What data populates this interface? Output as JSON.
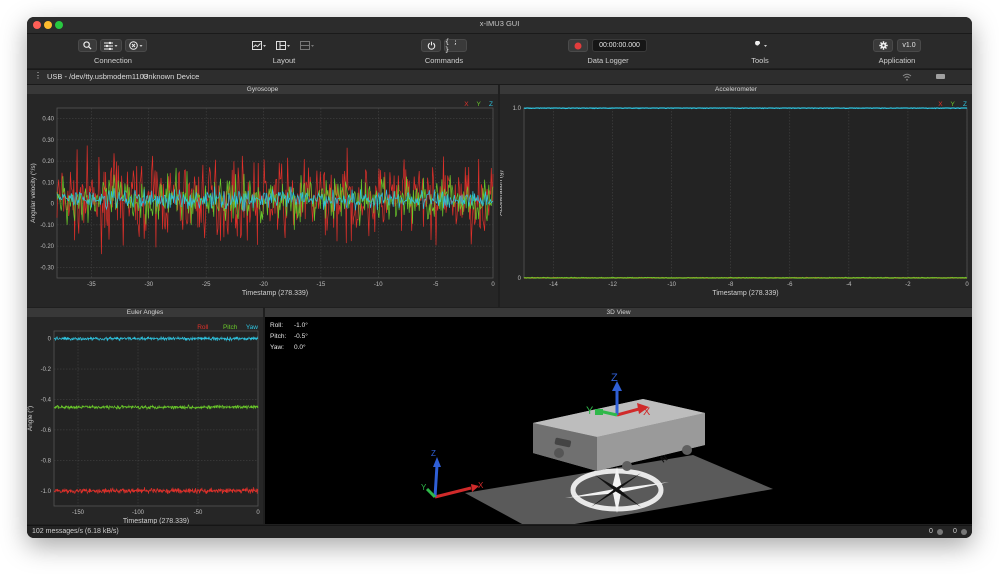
{
  "window": {
    "title": "x-IMU3 GUI"
  },
  "toolbar": {
    "connection_label": "Connection",
    "layout_label": "Layout",
    "commands_label": "Commands",
    "commands_btn": "{ ; }",
    "data_logger_label": "Data Logger",
    "timer": "00:00:00.000",
    "tools_label": "Tools",
    "application_label": "Application",
    "version": "v1.0"
  },
  "connection": {
    "port": "USB - /dev/tty.usbmodem1103",
    "device": "Unknown Device"
  },
  "gyroscope": {
    "title": "Gyroscope",
    "legend": [
      "X",
      "Y",
      "Z"
    ],
    "ylabel": "Angular velocity (°/s)",
    "xlabel": "Timestamp (278.339)",
    "yticks": [
      "0.40",
      "0.30",
      "0.20",
      "0.10",
      "0",
      "-0.10",
      "-0.20",
      "-0.30"
    ],
    "xticks": [
      "-35",
      "-30",
      "-25",
      "-20",
      "-15",
      "-10",
      "-5",
      "0"
    ]
  },
  "accelerometer": {
    "title": "Accelerometer",
    "legend": [
      "X",
      "Y",
      "Z"
    ],
    "ylabel": "Acceleration (g)",
    "xlabel": "Timestamp (278.339)",
    "yticks": [
      "1.0",
      "0"
    ],
    "xticks": [
      "-14",
      "-12",
      "-10",
      "-8",
      "-6",
      "-4",
      "-2",
      "0"
    ]
  },
  "euler": {
    "title": "Euler Angles",
    "legend": [
      "Roll",
      "Pitch",
      "Yaw"
    ],
    "ylabel": "Angle (°)",
    "xlabel": "Timestamp (278.339)",
    "yticks": [
      "0",
      "-0.2",
      "-0.4",
      "-0.6",
      "-0.8",
      "-1.0"
    ],
    "xticks": [
      "-150",
      "-100",
      "-50",
      "0"
    ]
  },
  "view3d": {
    "title": "3D View",
    "roll_label": "Roll:",
    "roll_value": "-1.0°",
    "pitch_label": "Pitch:",
    "pitch_value": "-0.5°",
    "yaw_label": "Yaw:",
    "yaw_value": "0.0°",
    "axis_x": "X",
    "axis_y": "Y",
    "axis_z": "Z",
    "compass_n": "N"
  },
  "status": {
    "rate": "102 messages/s (6.18 kB/s)",
    "count_a": "0",
    "count_b": "0"
  },
  "colors": {
    "x": "#e0302a",
    "y": "#6ac92a",
    "z": "#2ec4e0",
    "accent": "#e23c3c"
  },
  "chart_data": [
    {
      "type": "line",
      "title": "Gyroscope",
      "xlabel": "Timestamp (278.339)",
      "ylabel": "Angular velocity (°/s)",
      "xlim": [
        -38,
        0
      ],
      "ylim": [
        -0.35,
        0.45
      ],
      "series": [
        {
          "name": "X",
          "mean": 0.02,
          "spread": 0.3
        },
        {
          "name": "Y",
          "mean": 0.02,
          "spread": 0.18
        },
        {
          "name": "Z",
          "mean": 0.02,
          "spread": 0.08
        }
      ]
    },
    {
      "type": "line",
      "title": "Accelerometer",
      "xlabel": "Timestamp (278.339)",
      "ylabel": "Acceleration (g)",
      "xlim": [
        -15,
        0
      ],
      "ylim": [
        0,
        1.0
      ],
      "series": [
        {
          "name": "X",
          "values_const": 0.0
        },
        {
          "name": "Y",
          "values_const": 0.0
        },
        {
          "name": "Z",
          "values_const": 1.0
        }
      ]
    },
    {
      "type": "line",
      "title": "Euler Angles",
      "xlabel": "Timestamp (278.339)",
      "ylabel": "Angle (°)",
      "xlim": [
        -170,
        0
      ],
      "ylim": [
        -1.1,
        0.05
      ],
      "series": [
        {
          "name": "Roll",
          "mean": -1.0,
          "spread": 0.03
        },
        {
          "name": "Pitch",
          "mean": -0.45,
          "spread": 0.02
        },
        {
          "name": "Yaw",
          "mean": 0.0,
          "spread": 0.02
        }
      ]
    }
  ]
}
